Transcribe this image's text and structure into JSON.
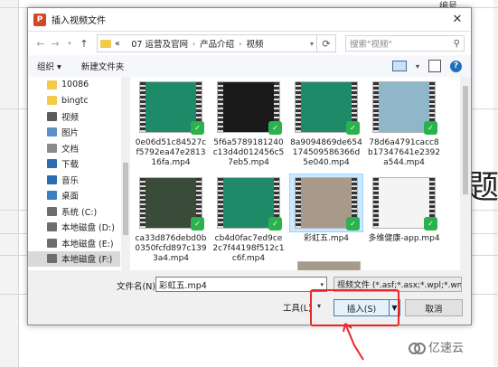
{
  "background": {
    "top_right_text": "编号",
    "big_char": "题",
    "watermark": "亿速云"
  },
  "dialog": {
    "title": "插入视频文件",
    "app_icon_letter": "P",
    "close_glyph": "✕",
    "address": {
      "crumbs": [
        "«",
        "07 运营及官网",
        "产品介绍",
        "视频"
      ]
    },
    "search_placeholder": "搜索\"视频\"",
    "toolbar": {
      "organize": "组织 ▾",
      "new_folder": "新建文件夹"
    },
    "nav_items": [
      {
        "label": "10086",
        "icon": "folder-icon",
        "color": "#f3c84b"
      },
      {
        "label": "bingtc",
        "icon": "folder-icon",
        "color": "#f3c84b"
      },
      {
        "label": "视频",
        "icon": "video-icon",
        "color": "#5b5b5b"
      },
      {
        "label": "图片",
        "icon": "pictures-icon",
        "color": "#5a8fc8"
      },
      {
        "label": "文档",
        "icon": "documents-icon",
        "color": "#8c8c8c"
      },
      {
        "label": "下载",
        "icon": "download-icon",
        "color": "#2b6cb3"
      },
      {
        "label": "音乐",
        "icon": "music-icon",
        "color": "#2b6cb3"
      },
      {
        "label": "桌面",
        "icon": "desktop-icon",
        "color": "#3b7fc4"
      },
      {
        "label": "系统 (C:)",
        "icon": "drive-icon",
        "color": "#6d6d6d"
      },
      {
        "label": "本地磁盘 (D:)",
        "icon": "drive-icon",
        "color": "#6d6d6d"
      },
      {
        "label": "本地磁盘 (E:)",
        "icon": "drive-icon",
        "color": "#6d6d6d"
      },
      {
        "label": "本地磁盘 (F:)",
        "icon": "drive-icon",
        "color": "#6d6d6d",
        "selected": true
      }
    ],
    "files": [
      {
        "name": "0e06d51c84527cf5792ea47e281316fa.mp4",
        "screen": "#1f8a68"
      },
      {
        "name": "5f6a5789181240c13d4d012456c57eb5.mp4",
        "screen": "#1a1a1a"
      },
      {
        "name": "8a9094869de654174509586366d5e040.mp4",
        "screen": "#1f8a68"
      },
      {
        "name": "78d6a4791cacc8b17347641e2392a544.mp4",
        "screen": "#8fb6c9"
      },
      {
        "name": "ca33d876debd0b0350fcfd897c1393a4.mp4",
        "screen": "#3a4b3a"
      },
      {
        "name": "cb4d0fac7ed9ce2c7f44198f512c1c6f.mp4",
        "screen": "#1f8a68"
      },
      {
        "name": "彩虹五.mp4",
        "screen": "#a79a8a",
        "selected": true
      },
      {
        "name": "多维健康-app.mp4",
        "screen": "#f4f4f4"
      }
    ],
    "filename_label": "文件名(N):",
    "filename_value": "彩虹五.mp4",
    "filetype_value": "视频文件 (*.asf;*.asx;*.wpl;*.wm",
    "tools_label": "工具(L)",
    "insert_label": "插入(S)",
    "cancel_label": "取消",
    "highlight_color": "#e8282b"
  }
}
